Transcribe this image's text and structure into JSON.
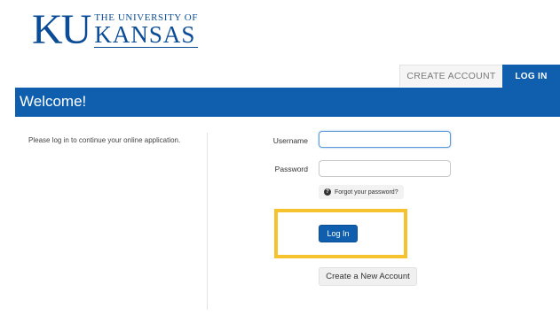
{
  "logo": {
    "mark": "KU",
    "line1": "THE UNIVERSITY OF",
    "line2": "KANSAS"
  },
  "tabs": {
    "create_account": "CREATE ACCOUNT",
    "log_in": "LOG IN"
  },
  "header": {
    "title": "Welcome!"
  },
  "info": {
    "text": "Please log in to continue your online application."
  },
  "form": {
    "username_label": "Username",
    "username_value": "",
    "password_label": "Password",
    "password_value": "",
    "forgot_label": "Forgot your password?",
    "login_button": "Log In",
    "create_button": "Create a New Account"
  },
  "icons": {
    "forgot": "question-circle-icon"
  },
  "colors": {
    "brand_blue": "#0f5fae",
    "highlight": "#f6c32e",
    "tab_inactive_bg": "#f5f5f5"
  }
}
